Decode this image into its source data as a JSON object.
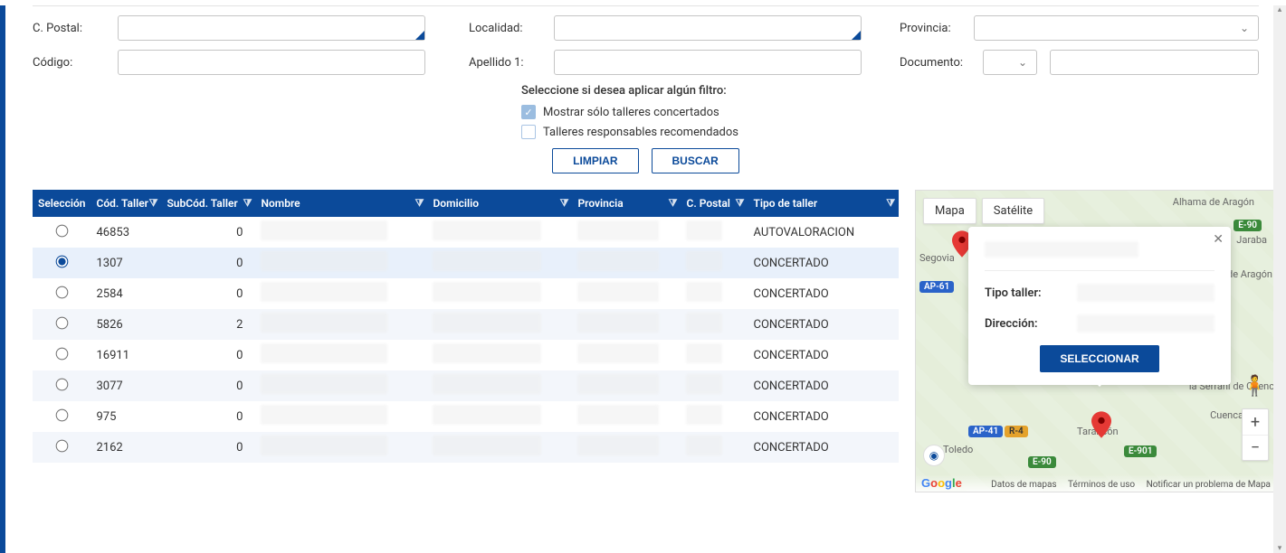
{
  "form": {
    "cpostal_label": "C. Postal:",
    "localidad_label": "Localidad:",
    "provincia_label": "Provincia:",
    "codigo_label": "Código:",
    "apellido_label": "Apellido 1:",
    "documento_label": "Documento:",
    "cpostal_value": "",
    "localidad_value": "",
    "provincia_value": "",
    "codigo_value": "",
    "apellido_value": "",
    "documento_type": "",
    "documento_value": ""
  },
  "filters": {
    "title": "Seleccione si desea aplicar algún filtro:",
    "opt1_label": "Mostrar sólo talleres concertados",
    "opt1_checked": true,
    "opt2_label": "Talleres responsables recomendados",
    "opt2_checked": false
  },
  "buttons": {
    "limpiar": "LIMPIAR",
    "buscar": "BUSCAR"
  },
  "table": {
    "headers": {
      "seleccion": "Selección",
      "cod_taller": "Cód. Taller",
      "subcod": "SubCód. Taller",
      "nombre": "Nombre",
      "domicilio": "Domicilio",
      "provincia": "Provincia",
      "cpostal": "C. Postal",
      "tipo": "Tipo de taller"
    },
    "rows": [
      {
        "selected": false,
        "cod": "46853",
        "sub": "0",
        "tipo": "AUTOVALORACION"
      },
      {
        "selected": true,
        "cod": "1307",
        "sub": "0",
        "tipo": "CONCERTADO"
      },
      {
        "selected": false,
        "cod": "2584",
        "sub": "0",
        "tipo": "CONCERTADO"
      },
      {
        "selected": false,
        "cod": "5826",
        "sub": "2",
        "tipo": "CONCERTADO"
      },
      {
        "selected": false,
        "cod": "16911",
        "sub": "0",
        "tipo": "CONCERTADO"
      },
      {
        "selected": false,
        "cod": "3077",
        "sub": "0",
        "tipo": "CONCERTADO"
      },
      {
        "selected": false,
        "cod": "975",
        "sub": "0",
        "tipo": "CONCERTADO"
      },
      {
        "selected": false,
        "cod": "2162",
        "sub": "0",
        "tipo": "CONCERTADO"
      }
    ]
  },
  "map": {
    "tabs": {
      "map": "Mapa",
      "satellite": "Satélite"
    },
    "info": {
      "tipo_label": "Tipo taller:",
      "dir_label": "Dirección:",
      "select_btn": "SELECCIONAR"
    },
    "labels": {
      "albama": "Alhama\nde Aragón",
      "jaraba": "Jaraba",
      "segovia": "Segovia",
      "molina": "Molina de\nAragón",
      "cuenca": "Cuenca",
      "serrania": "la Serraní\nde Cuenc",
      "toledo": "Toledo",
      "tarancon": "Tarancón"
    },
    "roads": {
      "e90a": "E-90",
      "e90b": "E-90",
      "ap61": "AP-61",
      "ap41": "AP-41",
      "r4": "R-4",
      "e901": "E-901"
    },
    "footer": {
      "datos": "Datos de mapas",
      "terminos": "Términos de uso",
      "notificar": "Notificar un problema de Mapa"
    }
  }
}
